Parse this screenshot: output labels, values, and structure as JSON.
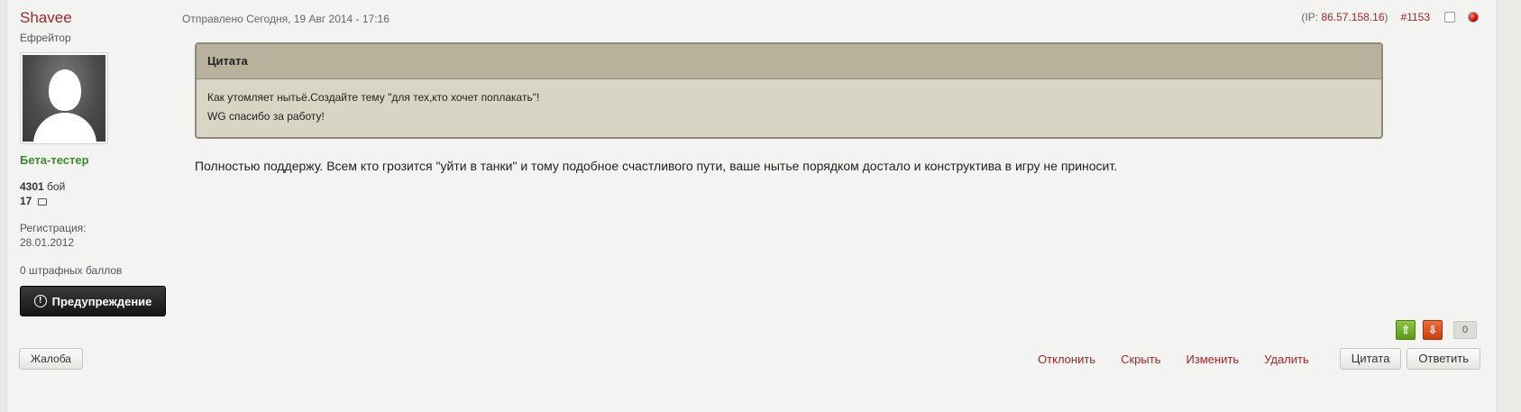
{
  "author": {
    "name": "Shavee",
    "rank": "Ефрейтор",
    "group": "Бета-тестер",
    "battles_count": "4301",
    "battles_label": "бой",
    "comments_count": "17",
    "reg_label": "Регистрация:",
    "reg_date": "28.01.2012",
    "penalty": "0 штрафных баллов",
    "warn_button": "Предупреждение"
  },
  "meta": {
    "posted": "Отправлено Сегодня, 19 Авг 2014 - 17:16",
    "ip_prefix": "(IP: ",
    "ip": "86.57.158.16",
    "ip_suffix": ")",
    "post_number": "#1153"
  },
  "quote": {
    "header": "Цитата",
    "line1": " Как утомляет нытьё.Создайте тему \"для тех,кто хочет поплакать\"!",
    "line2": "WG спасибо за работу!"
  },
  "post": {
    "text": "Полностью поддержу. Всем кто грозится \"уйти в танки\" и тому подобное счастливого пути, ваше нытье порядком достало и конструктива в игру не приносит."
  },
  "vote": {
    "up_icon": "arrow-up-icon",
    "down_icon": "arrow-down-icon",
    "count": "0"
  },
  "footer": {
    "report": "Жалоба",
    "reject": "Отклонить",
    "hide": "Скрыть",
    "edit": "Изменить",
    "delete": "Удалить",
    "quote": "Цитата",
    "reply": "Ответить"
  },
  "colors": {
    "accent": "#a3262b",
    "group": "#3b8a2e",
    "quote_bg": "#d8d5c4",
    "quote_header_bg": "#b8b19c"
  }
}
